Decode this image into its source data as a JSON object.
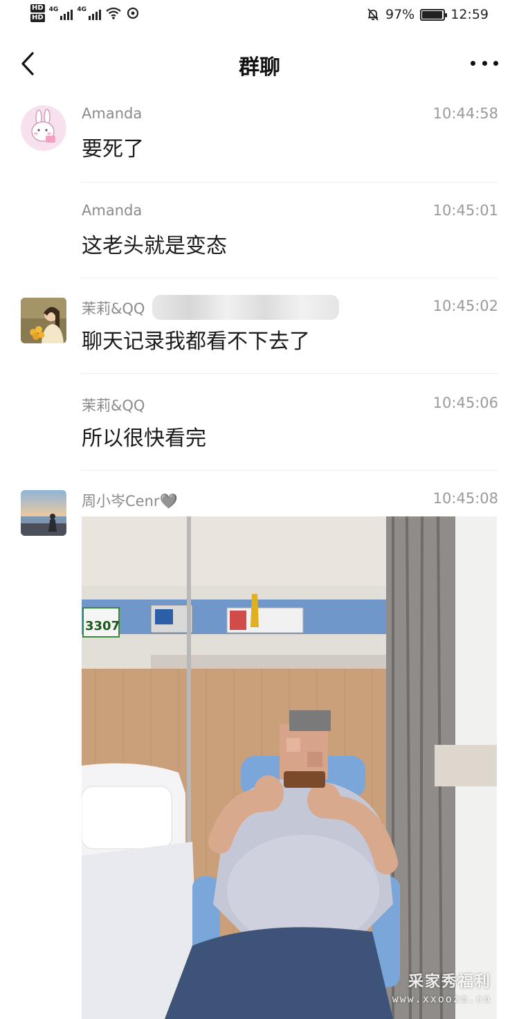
{
  "status_bar": {
    "hd1": "HD",
    "hd2": "HD",
    "net1": "4G",
    "net2": "4G",
    "battery": "97%",
    "battery_level": 0.97,
    "time": "12:59"
  },
  "header": {
    "title": "群聊"
  },
  "messages": [
    {
      "sender": "Amanda",
      "time": "10:44:58",
      "text": "要死了",
      "avatar": "bunny-avatar"
    },
    {
      "sender": "Amanda",
      "time": "10:45:01",
      "text": "这老头就是变态"
    },
    {
      "sender": "茉莉&QQ",
      "time": "10:45:02",
      "text": "聊天记录我都看不下去了",
      "avatar": "girl-sunflower-avatar"
    },
    {
      "sender": "茉莉&QQ",
      "time": "10:45:06",
      "text": "所以很快看完"
    },
    {
      "sender": "周小岑Cenr🩶",
      "time": "10:45:08",
      "avatar": "beach-avatar",
      "image": {
        "room_number": "3307"
      }
    }
  ],
  "watermark": {
    "line1": "采家秀福利",
    "line2": "www.xxoozm.co"
  },
  "icons": [
    "back-arrow-icon",
    "more-dots-icon",
    "mute-bell-icon",
    "wifi-icon",
    "battery-icon",
    "signal-icon"
  ]
}
